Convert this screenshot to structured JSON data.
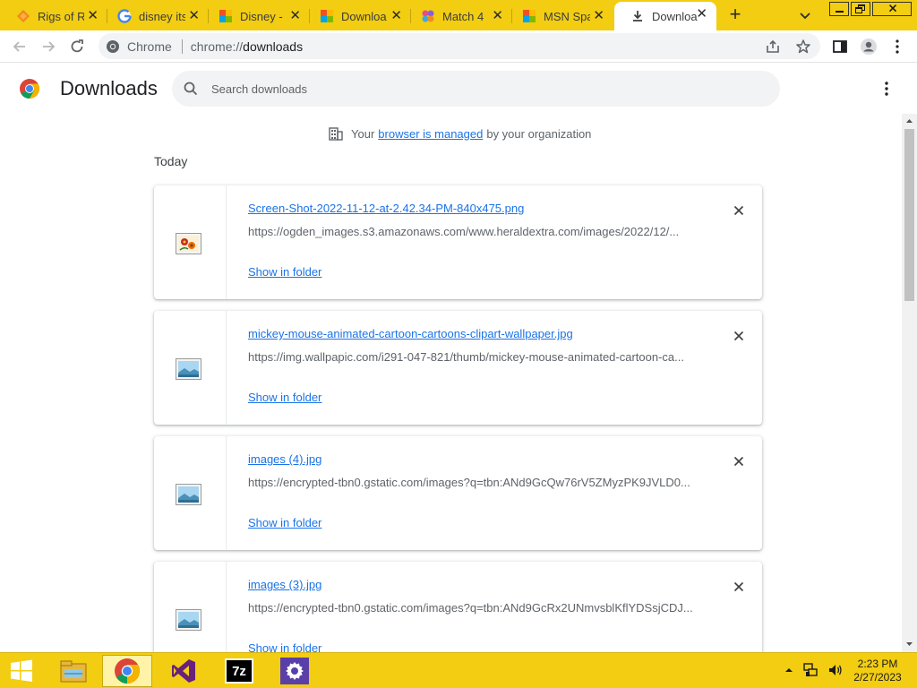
{
  "tabs": [
    {
      "label": "Rigs of R",
      "icon": "rigs-of-rods-icon",
      "active": false
    },
    {
      "label": "disney its",
      "icon": "google-icon",
      "active": false
    },
    {
      "label": "Disney -",
      "icon": "msn-icon",
      "active": false
    },
    {
      "label": "Downloa",
      "icon": "msn-icon",
      "active": false
    },
    {
      "label": "Match 4",
      "icon": "game-icon",
      "active": false
    },
    {
      "label": "MSN Spa",
      "icon": "msn-icon",
      "active": false
    },
    {
      "label": "Downloa",
      "icon": "download-icon",
      "active": true
    }
  ],
  "toolbar": {
    "chip_label": "Chrome",
    "url_scheme": "chrome://",
    "url_host": "downloads"
  },
  "header": {
    "title": "Downloads",
    "search_placeholder": "Search downloads"
  },
  "managed": {
    "prefix": "Your",
    "link": "browser is managed",
    "suffix": "by your organization"
  },
  "section_label": "Today",
  "downloads": [
    {
      "filename": "Screen-Shot-2022-11-12-at-2.42.34-PM-840x475.png",
      "url": "https://ogden_images.s3.amazonaws.com/www.heraldextra.com/images/2022/12/...",
      "action": "Show in folder",
      "icon": "flower-image-icon"
    },
    {
      "filename": "mickey-mouse-animated-cartoon-cartoons-clipart-wallpaper.jpg",
      "url": "https://img.wallpapic.com/i291-047-821/thumb/mickey-mouse-animated-cartoon-ca...",
      "action": "Show in folder",
      "icon": "image-file-icon"
    },
    {
      "filename": "images (4).jpg",
      "url": "https://encrypted-tbn0.gstatic.com/images?q=tbn:ANd9GcQw76rV5ZMyzPK9JVLD0...",
      "action": "Show in folder",
      "icon": "image-file-icon"
    },
    {
      "filename": "images (3).jpg",
      "url": "https://encrypted-tbn0.gstatic.com/images?q=tbn:ANd9GcRx2UNmvsblKflYDSsjCDJ...",
      "action": "Show in folder",
      "icon": "image-file-icon"
    }
  ],
  "taskbar": {
    "apps": [
      "start-icon",
      "file-explorer-icon",
      "chrome-icon",
      "visual-studio-icon",
      "7zip-icon",
      "settings-icon"
    ],
    "seven_zip_label": "7z",
    "time": "2:23 PM",
    "date": "2/27/2023"
  },
  "colors": {
    "chrome_frame": "#f2cd12",
    "link": "#1a73e8",
    "secondary_text": "#5f6368"
  }
}
